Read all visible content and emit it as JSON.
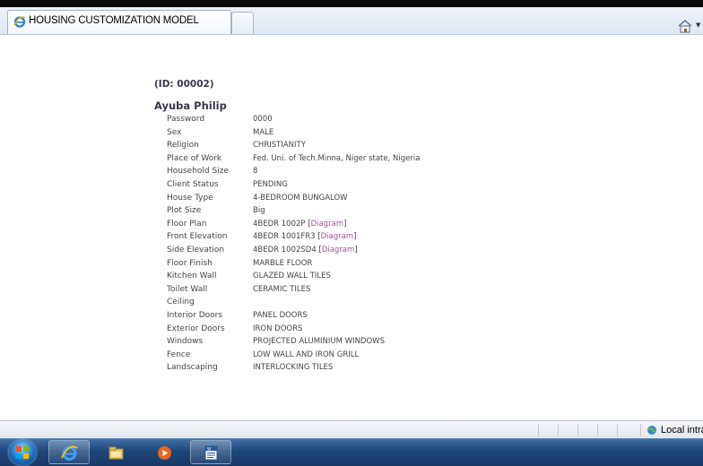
{
  "browser": {
    "tab_title": "HOUSING CUSTOMIZATION MODEL",
    "status_zone": "Local intra"
  },
  "client": {
    "id_label": "(ID: 00002)",
    "name": "Ayuba Philip"
  },
  "details": [
    {
      "label": "Password",
      "value": "0000"
    },
    {
      "label": "Sex",
      "value": "MALE"
    },
    {
      "label": "Religion",
      "value": "CHRISTIANITY"
    },
    {
      "label": "Place of Work",
      "value": "Fed. Uni. of Tech.Minna, Niger state, Nigeria"
    },
    {
      "label": "Household Size",
      "value": "8"
    },
    {
      "label": "Client Status",
      "value": "PENDING"
    },
    {
      "label": "House Type",
      "value": "4-BEDROOM BUNGALOW"
    },
    {
      "label": "Plot Size",
      "value": "Big"
    },
    {
      "label": "Floor Plan",
      "value": "4BEDR 1002P",
      "link": "Diagram"
    },
    {
      "label": "Front Elevation",
      "value": "4BEDR 1001FR3",
      "link": "Diagram"
    },
    {
      "label": "Side Elevation",
      "value": "4BEDR 1002SD4",
      "link": "Diagram"
    },
    {
      "label": "Floor Finish",
      "value": "MARBLE FLOOR"
    },
    {
      "label": "Kitchen Wall",
      "value": "GLAZED WALL TILES"
    },
    {
      "label": "Toilet Wall",
      "value": "CERAMIC TILES"
    },
    {
      "label": "Ceiling",
      "value": ""
    },
    {
      "label": "Interior Doors",
      "value": "PANEL DOORS"
    },
    {
      "label": "Exterior Doors",
      "value": "IRON DOORS"
    },
    {
      "label": "Windows",
      "value": "PROJECTED ALUMINIUM WINDOWS"
    },
    {
      "label": "Fence",
      "value": "LOW WALL AND IRON GRILL"
    },
    {
      "label": "Landscaping",
      "value": "INTERLOCKING TILES"
    }
  ],
  "taskbar": {
    "items": [
      "start-orb",
      "internet-explorer-icon",
      "file-explorer-icon",
      "media-player-icon",
      "word-icon"
    ]
  },
  "colors": {
    "link": "#a0529a",
    "text": "#444444",
    "heading": "#36384a",
    "taskbar": "#1e4678"
  }
}
